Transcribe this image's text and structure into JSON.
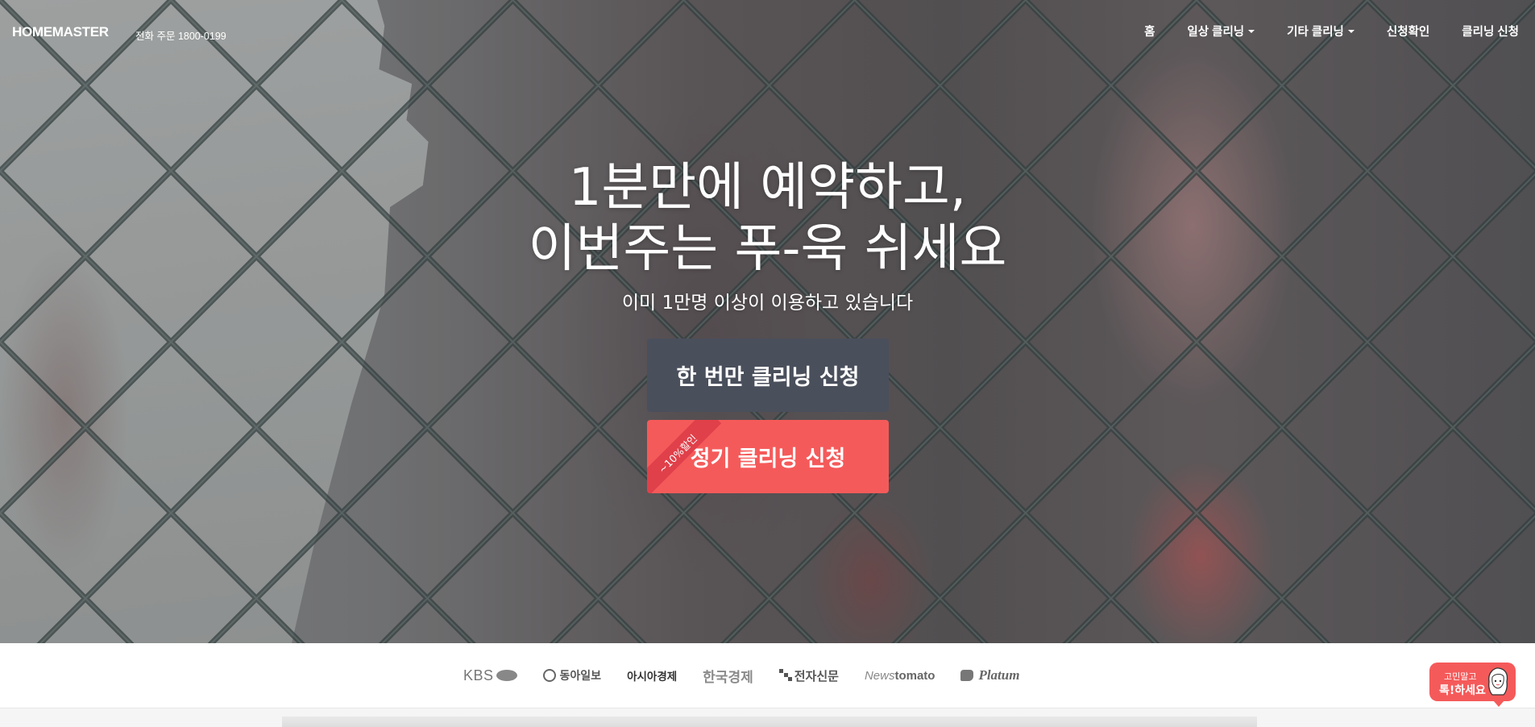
{
  "brand": {
    "logo": "HOMEMASTER",
    "phone": "전화 주문 1800-0199"
  },
  "nav": {
    "items": [
      {
        "label": "홈",
        "has_dropdown": false
      },
      {
        "label": "일상 클리닝",
        "has_dropdown": true
      },
      {
        "label": "기타 클리닝",
        "has_dropdown": true
      },
      {
        "label": "신청확인",
        "has_dropdown": false
      },
      {
        "label": "클리닝 신청",
        "has_dropdown": false
      }
    ]
  },
  "hero": {
    "headline_line1": "1분만에 예약하고,",
    "headline_line2": "이번주는 푸-욱 쉬세요",
    "subline": "이미 1만명 이상이 이용하고 있습니다",
    "btn_once": "한 번만 클리닝 신청",
    "btn_regular": "정기 클리닝 신청",
    "discount_ribbon": "~10%할인"
  },
  "press": {
    "logos": {
      "kbs": "KBS",
      "donga": "동아일보",
      "asia": "아시아경제",
      "hankyung": "한국경제",
      "etnews": "전자신문",
      "tomato_a": "News",
      "tomato_b": "tomato",
      "platum": "Platum"
    }
  },
  "chat": {
    "line1": "고민말고",
    "line2": "톡!하세요"
  },
  "colors": {
    "primary_red": "#f55a5a",
    "dark_button": "#4a4f5c",
    "white": "#ffffff"
  }
}
